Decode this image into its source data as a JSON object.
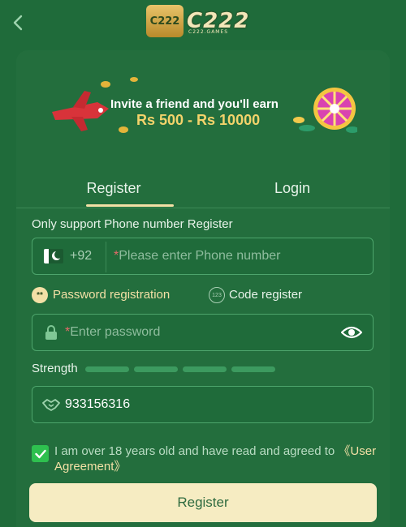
{
  "header": {
    "logo_badge": "C222",
    "logo_text": "C222",
    "logo_sub": "C222.GAMES"
  },
  "banner": {
    "line1": "Invite a friend and you'll earn",
    "line2": "Rs 500 - Rs 10000"
  },
  "tabs": [
    {
      "label": "Register",
      "active": true
    },
    {
      "label": "Login",
      "active": false
    }
  ],
  "form": {
    "hint": "Only support Phone number Register",
    "phone": {
      "country_code": "+92",
      "required_mark": "*",
      "placeholder": "Please enter Phone number"
    },
    "modes": [
      {
        "icon_text": "**",
        "label": "Password registration",
        "active": true
      },
      {
        "icon_text": "123",
        "label": "Code register",
        "active": false
      }
    ],
    "password": {
      "required_mark": "*",
      "placeholder": "Enter password"
    },
    "strength": {
      "label": "Strength",
      "segments": 4,
      "filled": 0
    },
    "invite_code": {
      "value": "933156316"
    },
    "agreement": {
      "checked": true,
      "text": "I am over 18 years old and have read and agreed to ",
      "link": "《User Agreement》"
    },
    "submit_label": "Register"
  },
  "colors": {
    "background": "#1f6b3a",
    "card": "#236e3d",
    "accent": "#f3e0a6",
    "button": "#f6ecc2",
    "checkbox": "#2ec04f"
  },
  "icons": [
    "back-chevron-icon",
    "pakistan-flag-icon",
    "lock-icon",
    "eye-icon",
    "handshake-icon",
    "checkmark-icon"
  ]
}
